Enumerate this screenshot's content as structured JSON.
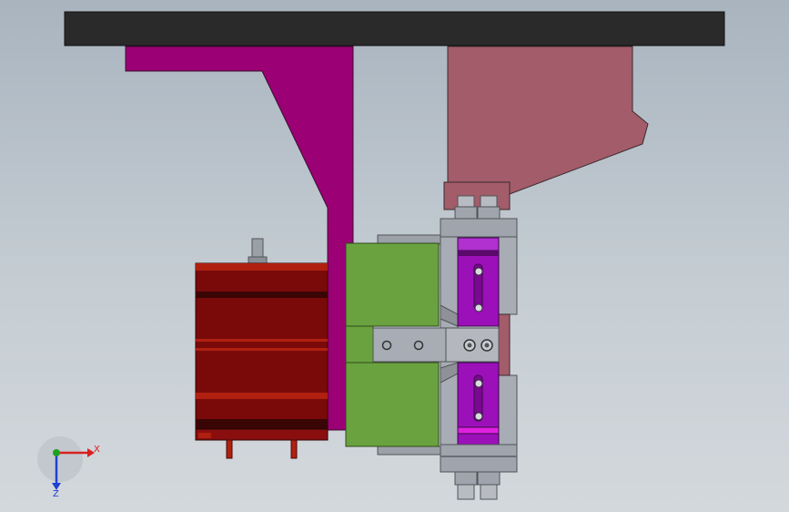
{
  "axes": {
    "x_label": "X",
    "z_label": "Z",
    "x_color": "#d92020",
    "y_color": "#20a020",
    "z_color": "#2040d0"
  },
  "colors": {
    "top_beam": "#2a2a2a",
    "bracket": "#9b0074",
    "pink_block": "#a35c69",
    "motor_body": "#7a0a0a",
    "motor_band": "#b02010",
    "green_block": "#6aa23f",
    "gray_metal": "#a0a4ac",
    "purple_jaw": "#9b10b8",
    "magenta_strip": "#e020e0"
  }
}
